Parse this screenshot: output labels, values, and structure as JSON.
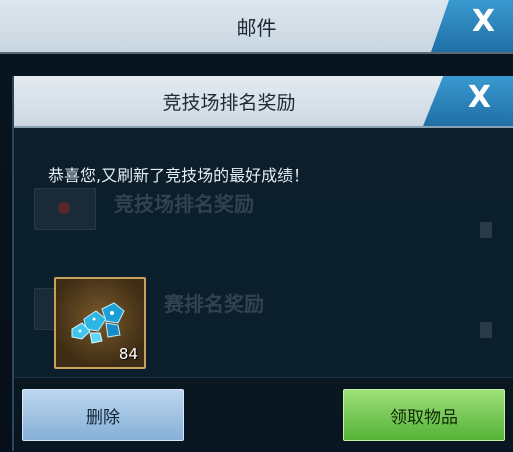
{
  "mail_window": {
    "title": "邮件",
    "close_label": "X",
    "ghost_rows": [
      {
        "title": "竞技场排名奖励"
      },
      {
        "title": "赛排名奖励"
      }
    ]
  },
  "reward_dialog": {
    "title": "竞技场排名奖励",
    "close_label": "X",
    "message": "恭喜您,又刷新了竞技场的最好成绩！",
    "item": {
      "icon": "blue-gems-icon",
      "count": "84",
      "frame_color": "#c7a25a"
    },
    "buttons": {
      "delete_label": "删除",
      "claim_label": "领取物品"
    }
  },
  "colors": {
    "close_button": "#2a86c0",
    "delete_button": "#86b0d6",
    "claim_button": "#55b236"
  }
}
